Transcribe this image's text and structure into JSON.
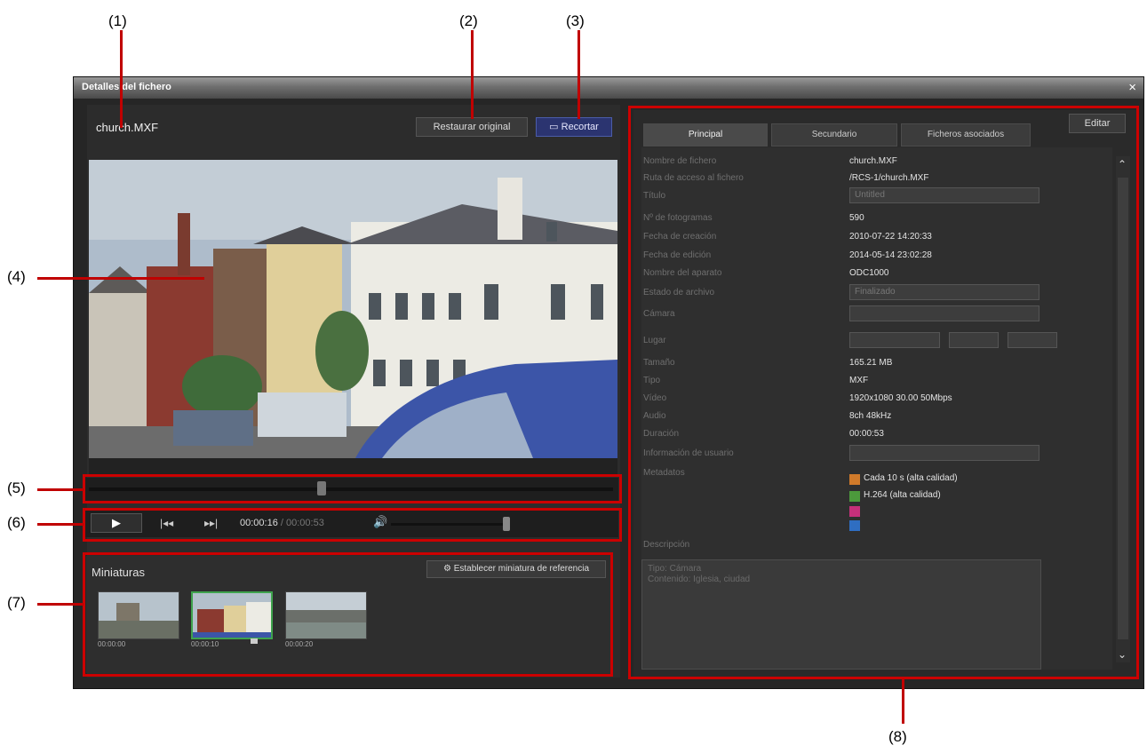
{
  "callouts": [
    "(1)",
    "(2)",
    "(3)",
    "(4)",
    "(5)",
    "(6)",
    "(7)",
    "(8)"
  ],
  "window": {
    "title": "Detalles del fichero",
    "close_glyph": "×"
  },
  "file": {
    "name": "church.MXF"
  },
  "buttons": {
    "restore": "Restaurar original",
    "crop": "Recortar",
    "set_thumb": "Establecer miniatura de referencia",
    "edit": "Editar"
  },
  "playback": {
    "play_glyph": "▶",
    "prev_glyph": "|◂◂",
    "next_glyph": "▸▸|",
    "timecode": "00:00:16",
    "separator": " / ",
    "duration": "00:00:53",
    "volume_glyph": "🔊"
  },
  "thumbnails": {
    "label": "Miniaturas",
    "items": [
      {
        "tc": "00:00:00"
      },
      {
        "tc": "00:00:10"
      },
      {
        "tc": "00:00:20"
      }
    ]
  },
  "tabs": [
    "Principal",
    "Secundario",
    "Ficheros asociados"
  ],
  "properties": [
    {
      "label": "Nombre de fichero",
      "value": "church.MXF"
    },
    {
      "label": "Ruta de acceso al fichero",
      "value": "/RCS-1/church.MXF"
    },
    {
      "label": "Título",
      "value": "Untitled"
    },
    {
      "label": "Nº de fotogramas",
      "value": "590"
    },
    {
      "label": "Fecha de creación",
      "value": "2010-07-22 14:20:33"
    },
    {
      "label": "Fecha de edición",
      "value": "2014-05-14 23:02:28"
    },
    {
      "label": "Nombre del aparato",
      "value": "ODC1000"
    },
    {
      "label": "Estado de archivo",
      "value": "Finalizado"
    },
    {
      "label": "Cámara",
      "value": ""
    },
    {
      "label": "Lugar",
      "value": ""
    },
    {
      "label": "Tamaño",
      "value": "165.21 MB"
    },
    {
      "label": "Tipo",
      "value": "MXF"
    },
    {
      "label": "Vídeo",
      "value": "1920x1080 30.00 50Mbps"
    },
    {
      "label": "Audio",
      "value": "8ch 48kHz"
    },
    {
      "label": "Duración",
      "value": "00:00:53"
    },
    {
      "label": "Información de usuario",
      "value": ""
    },
    {
      "label": "Metadatos",
      "value": ""
    }
  ],
  "meta_items": [
    "Cada 10 s (alta calidad)",
    "H.264 (alta calidad)"
  ],
  "description": {
    "label": "Descripción",
    "line1": "Tipo:  Cámara",
    "line2": "Contenido:  Iglesia,  ciudad"
  },
  "colors": {
    "callout_red": "#cc0000",
    "accent_blue": "#2b3470",
    "selected_green": "#3fa34d"
  }
}
